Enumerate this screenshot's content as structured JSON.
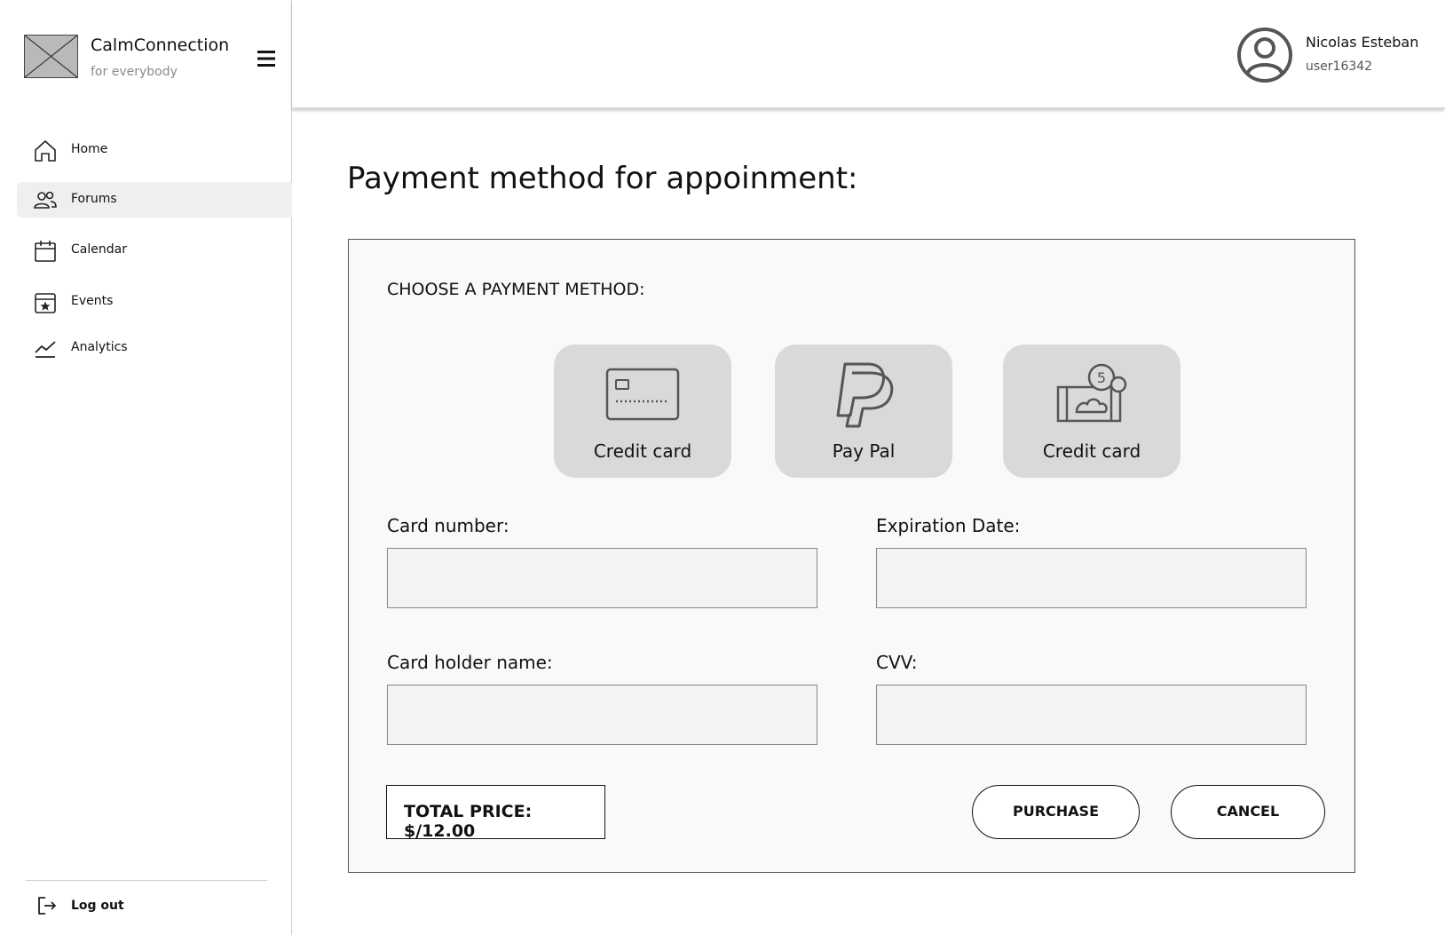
{
  "brand": {
    "name": "CalmConnection",
    "tagline": "for everybody",
    "logo_icon": "image-placeholder-icon",
    "menu_icon": "hamburger-menu-icon"
  },
  "sidebar": {
    "items": [
      {
        "label": "Home",
        "icon": "home-icon",
        "active": false
      },
      {
        "label": "Forums",
        "icon": "users-icon",
        "active": true
      },
      {
        "label": "Calendar",
        "icon": "calendar-icon",
        "active": false
      },
      {
        "label": "Events",
        "icon": "star-calendar-icon",
        "active": false
      },
      {
        "label": "Analytics",
        "icon": "line-chart-icon",
        "active": false
      }
    ],
    "logout": {
      "label": "Log out",
      "icon": "logout-icon"
    }
  },
  "header": {
    "user_name": "Nicolas Esteban",
    "user_id": "user16342",
    "avatar_icon": "user-circle-icon"
  },
  "main": {
    "title": "Payment method for appoinment:",
    "choose_label": "CHOOSE A PAYMENT METHOD:",
    "methods": [
      {
        "label": "Credit card",
        "icon": "credit-card-icon"
      },
      {
        "label": "Pay Pal",
        "icon": "paypal-icon"
      },
      {
        "label": "Credit card",
        "icon": "cash-coins-icon"
      }
    ],
    "fields": {
      "card_number": {
        "label": "Card number:",
        "value": "",
        "placeholder": ""
      },
      "expiration": {
        "label": "Expiration Date:",
        "value": "",
        "placeholder": ""
      },
      "holder_name": {
        "label": "Card holder name:",
        "value": "",
        "placeholder": ""
      },
      "cvv": {
        "label": "CVV:",
        "value": "",
        "placeholder": ""
      }
    },
    "total_price": "TOTAL PRICE: $/12.00",
    "purchase_label": "PURCHASE",
    "cancel_label": "CANCEL"
  },
  "colors": {
    "active_nav_bg": "#efefef",
    "method_card_bg": "#d9d9d9",
    "panel_bg": "#f9f9f9",
    "input_bg": "#f3f3f3"
  }
}
